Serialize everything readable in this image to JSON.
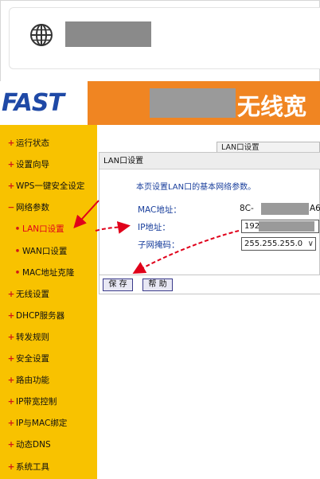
{
  "browser": {
    "icon": "globe-icon"
  },
  "header": {
    "logo": "FAST",
    "banner_title": "无线宽"
  },
  "sidebar": {
    "items": [
      {
        "label": "运行状态",
        "bullet": "+",
        "level": "top"
      },
      {
        "label": "设置向导",
        "bullet": "+",
        "level": "top"
      },
      {
        "label": "WPS一键安全设定",
        "bullet": "+",
        "level": "top"
      },
      {
        "label": "网络参数",
        "bullet": "−",
        "level": "top"
      },
      {
        "label": "LAN口设置",
        "bullet": "•",
        "level": "sub",
        "active": true
      },
      {
        "label": "WAN口设置",
        "bullet": "•",
        "level": "sub"
      },
      {
        "label": "MAC地址克隆",
        "bullet": "•",
        "level": "sub"
      },
      {
        "label": "无线设置",
        "bullet": "+",
        "level": "top"
      },
      {
        "label": "DHCP服务器",
        "bullet": "+",
        "level": "top"
      },
      {
        "label": "转发规则",
        "bullet": "+",
        "level": "top"
      },
      {
        "label": "安全设置",
        "bullet": "+",
        "level": "top"
      },
      {
        "label": "路由功能",
        "bullet": "+",
        "level": "top"
      },
      {
        "label": "IP带宽控制",
        "bullet": "+",
        "level": "top"
      },
      {
        "label": "IP与MAC绑定",
        "bullet": "+",
        "level": "top"
      },
      {
        "label": "动态DNS",
        "bullet": "+",
        "level": "top"
      },
      {
        "label": "系统工具",
        "bullet": "+",
        "level": "top"
      }
    ]
  },
  "tab": {
    "label": "LAN口设置"
  },
  "panel": {
    "title": "LAN口设置",
    "description": "本页设置LAN口的基本网络参数。",
    "mac_label": "MAC地址：",
    "mac_prefix": "8C-",
    "mac_suffix": "A6",
    "ip_label": "IP地址：",
    "ip_value": "192.",
    "mask_label": "子网掩码：",
    "mask_value": "255.255.255.0",
    "save_label": "保 存",
    "help_label": "帮 助"
  },
  "colors": {
    "sidebar_bg": "#f8c200",
    "header_orange": "#f08522",
    "logo_blue": "#1f49a6",
    "arrow_red": "#e0001a"
  }
}
